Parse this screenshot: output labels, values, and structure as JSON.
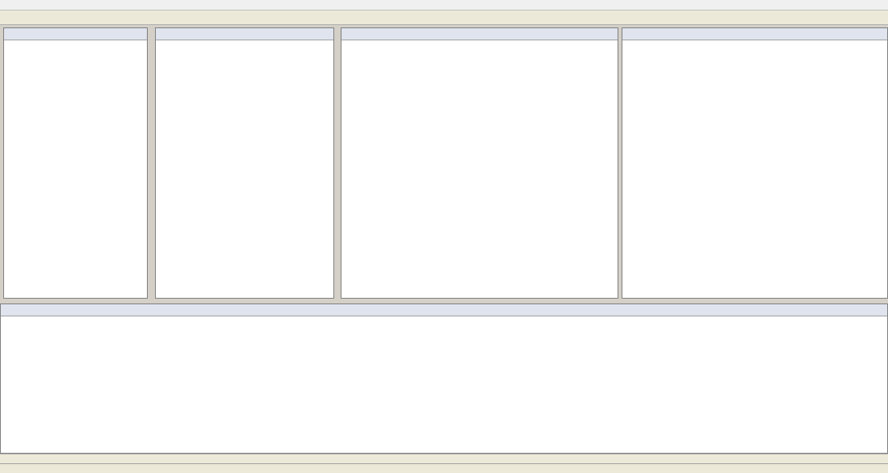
{
  "window": {
    "status": ""
  }
}
